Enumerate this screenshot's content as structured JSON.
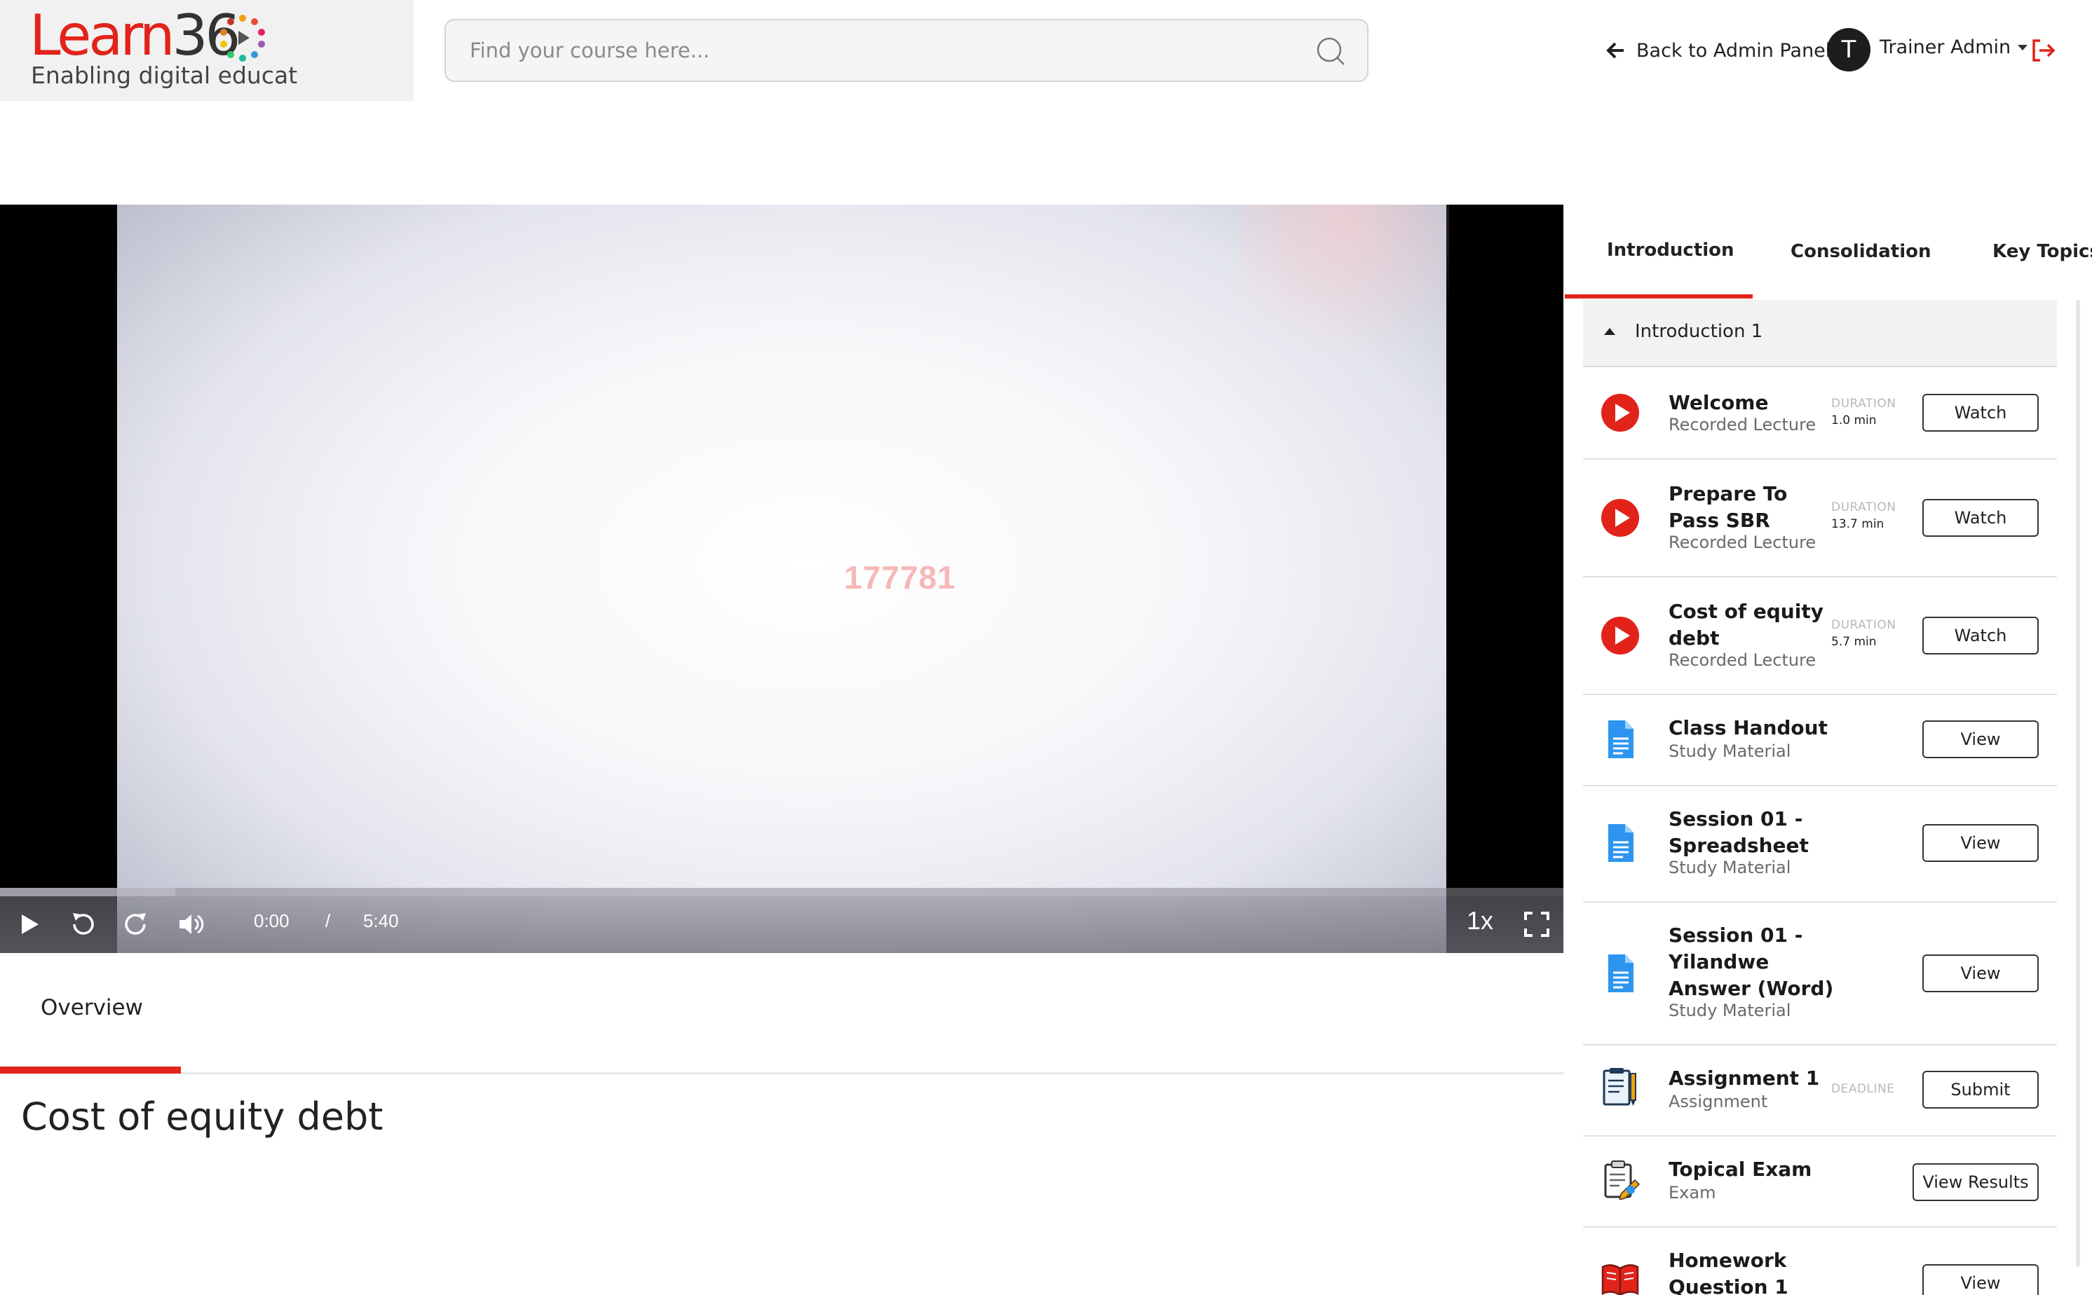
{
  "colors": {
    "accent": "#e2231a",
    "play_icon": "#e2231a",
    "doc_icon": "#2d95ef"
  },
  "header": {
    "logo_learn": "Learn",
    "logo_36": "36",
    "logo_tagline": "Enabling digital educat",
    "search_placeholder": "Find your course here...",
    "back_label": "Back to Admin Panel",
    "avatar_initial": "T",
    "user_name": "Trainer Admin"
  },
  "video": {
    "watermark": "177781",
    "current_time": "0:00",
    "separator": "/",
    "duration": "5:40",
    "speed": "1x"
  },
  "overview": {
    "tab_label": "Overview",
    "lesson_title": "Cost of equity debt"
  },
  "sidebar": {
    "tabs": [
      {
        "label": "Introduction",
        "active": true
      },
      {
        "label": "Consolidation",
        "active": false
      },
      {
        "label": "Key Topics",
        "active": false
      }
    ],
    "section_title": "Introduction 1",
    "items": [
      {
        "title": "Welcome",
        "subtitle": "Recorded Lecture",
        "meta_label": "DURATION",
        "meta_value": "1.0 min",
        "action": "Watch",
        "icon": "play-icon"
      },
      {
        "title": "Prepare To Pass SBR",
        "subtitle": "Recorded Lecture",
        "meta_label": "DURATION",
        "meta_value": "13.7 min",
        "action": "Watch",
        "icon": "play-icon"
      },
      {
        "title": "Cost of equity debt",
        "subtitle": "Recorded Lecture",
        "meta_label": "DURATION",
        "meta_value": "5.7 min",
        "action": "Watch",
        "icon": "play-icon"
      },
      {
        "title": "Class Handout",
        "subtitle": "Study Material",
        "meta_label": "",
        "meta_value": "",
        "action": "View",
        "icon": "document-icon"
      },
      {
        "title": "Session 01 - Spreadsheet",
        "subtitle": "Study Material",
        "meta_label": "",
        "meta_value": "",
        "action": "View",
        "icon": "document-icon"
      },
      {
        "title": "Session 01 - Yilandwe Answer (Word)",
        "subtitle": "Study Material",
        "meta_label": "",
        "meta_value": "",
        "action": "View",
        "icon": "document-icon"
      },
      {
        "title": "Assignment 1",
        "subtitle": "Assignment",
        "meta_label": "DEADLINE",
        "meta_value": "",
        "action": "Submit",
        "icon": "assignment-icon"
      },
      {
        "title": "Topical Exam",
        "subtitle": "Exam",
        "meta_label": "",
        "meta_value": "",
        "action": "View Results",
        "icon": "exam-icon"
      },
      {
        "title": "Homework Question 1",
        "subtitle": "",
        "meta_label": "",
        "meta_value": "",
        "action": "View",
        "icon": "book-icon"
      }
    ]
  }
}
